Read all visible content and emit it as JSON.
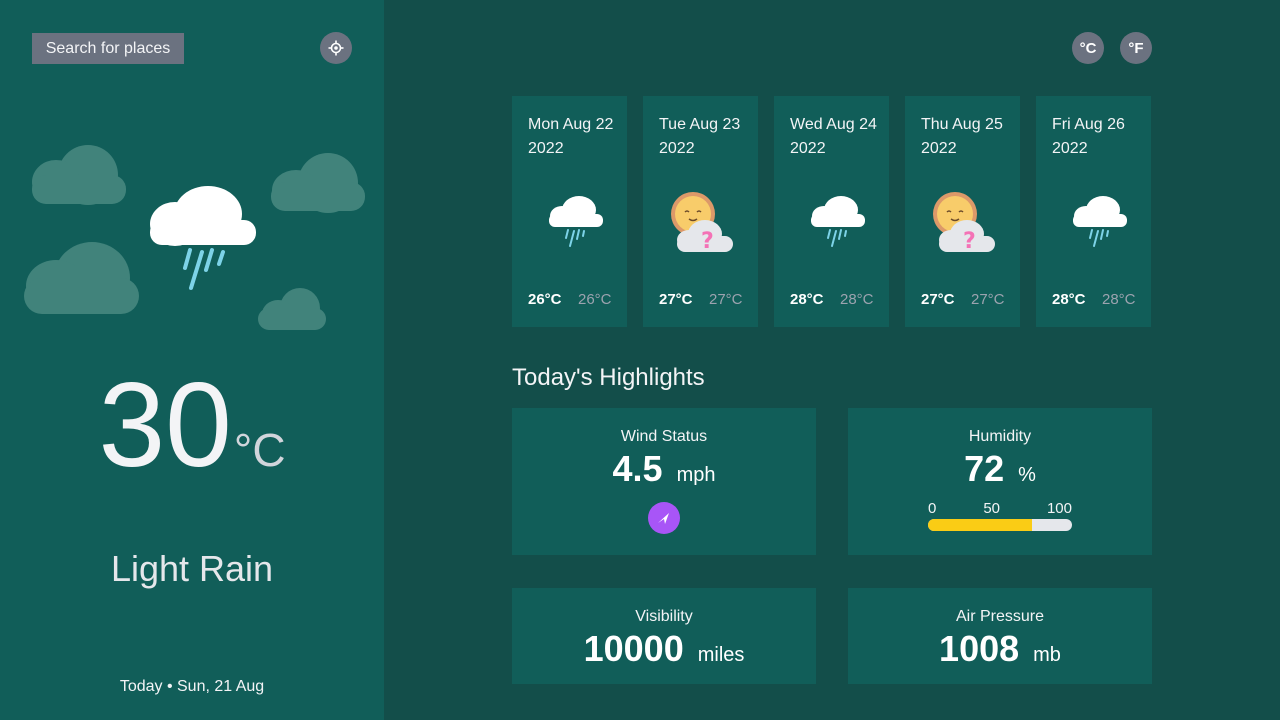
{
  "sidebar": {
    "search_label": "Search for places",
    "current_temp": "30",
    "temp_unit": "°C",
    "condition": "Light Rain",
    "date_line": "Today • Sun, 21 Aug",
    "icon": "light-rain-icon"
  },
  "units": {
    "celsius": "°C",
    "fahrenheit": "°F"
  },
  "forecast": [
    {
      "date": "Mon Aug 22 2022",
      "max": "26°C",
      "min": "26°C",
      "icon": "light-rain-icon"
    },
    {
      "date": "Tue Aug 23 2022",
      "max": "27°C",
      "min": "27°C",
      "icon": "unknown-weather-icon"
    },
    {
      "date": "Wed Aug 24 2022",
      "max": "28°C",
      "min": "28°C",
      "icon": "light-rain-icon"
    },
    {
      "date": "Thu Aug 25 2022",
      "max": "27°C",
      "min": "27°C",
      "icon": "unknown-weather-icon"
    },
    {
      "date": "Fri Aug 26 2022",
      "max": "28°C",
      "min": "28°C",
      "icon": "light-rain-icon"
    }
  ],
  "highlights": {
    "title": "Today's Highlights",
    "wind": {
      "label": "Wind Status",
      "value": "4.5",
      "unit": "mph",
      "icon": "wind-direction-icon"
    },
    "humidity": {
      "label": "Humidity",
      "value": "72",
      "unit": "%",
      "scale": [
        "0",
        "50",
        "100"
      ],
      "fill_percent": 72
    },
    "visibility": {
      "label": "Visibility",
      "value": "10000",
      "unit": "miles"
    },
    "pressure": {
      "label": "Air Pressure",
      "value": "1008",
      "unit": "mb"
    }
  },
  "colors": {
    "background": "#134e4a",
    "panel": "#115e59",
    "button": "#6b7280",
    "accent_wind": "#a855f7",
    "humidity_bar": "#facc15"
  }
}
